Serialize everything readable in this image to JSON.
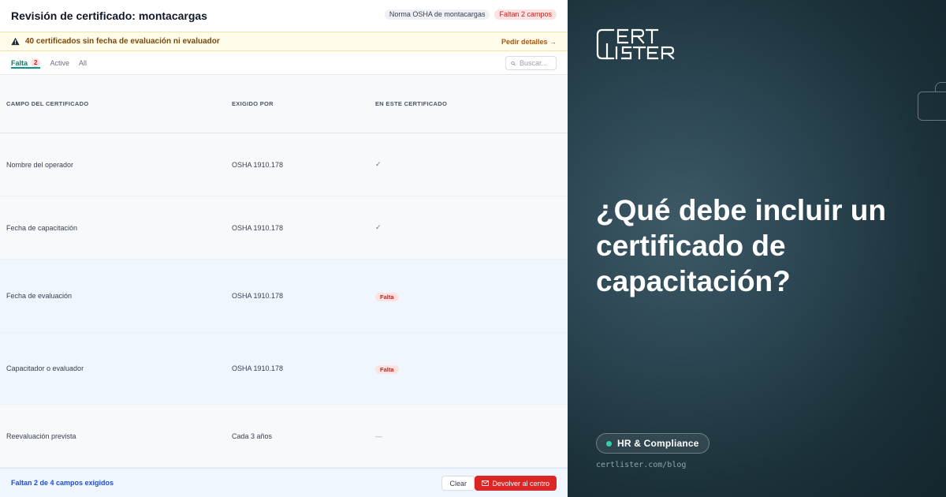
{
  "app": {
    "title": "Revisión de certificado: montacargas",
    "badges": [
      "Norma OSHA de montacargas",
      "Faltan 2 campos"
    ],
    "warning": {
      "text": "40 certificados sin fecha de evaluación ni evaluador",
      "link": "Pedir detalles →"
    },
    "tabs": [
      {
        "label": "Falta",
        "count": "2"
      },
      {
        "label": "Active"
      },
      {
        "label": "All"
      }
    ],
    "search": {
      "placeholder": "Buscar..."
    },
    "table": {
      "headers": [
        "CAMPO DEL CERTIFICADO",
        "EXIGIDO POR",
        "EN ESTE CERTIFICADO"
      ],
      "rows": [
        {
          "field": "Nombre del operador",
          "required_by": "OSHA 1910.178",
          "status": "✓"
        },
        {
          "field": "Fecha de capacitación",
          "required_by": "OSHA 1910.178",
          "status": "✓"
        },
        {
          "field": "Fecha de evaluación",
          "required_by": "OSHA 1910.178",
          "status": "Falta"
        },
        {
          "field": "Capacitador o evaluador",
          "required_by": "OSHA 1910.178",
          "status": "Falta"
        },
        {
          "field": "Reevaluación prevista",
          "required_by": "Cada 3 años",
          "status": "—"
        }
      ]
    },
    "footer": {
      "summary": "Faltan 2 de 4 campos exigidos",
      "clear_label": "Clear",
      "return_label": "Devolver al centro"
    }
  },
  "promo": {
    "headline": "¿Qué debe incluir un certificado de capacitación?",
    "category": "HR & Compliance",
    "url": "certlister.com/blog",
    "logo_text": "CERTLISTER"
  },
  "colors": {
    "accent_teal": "#0d9488",
    "danger": "#dc2626",
    "info": "#1d4ed8",
    "warning_bg": "#fffbea"
  }
}
